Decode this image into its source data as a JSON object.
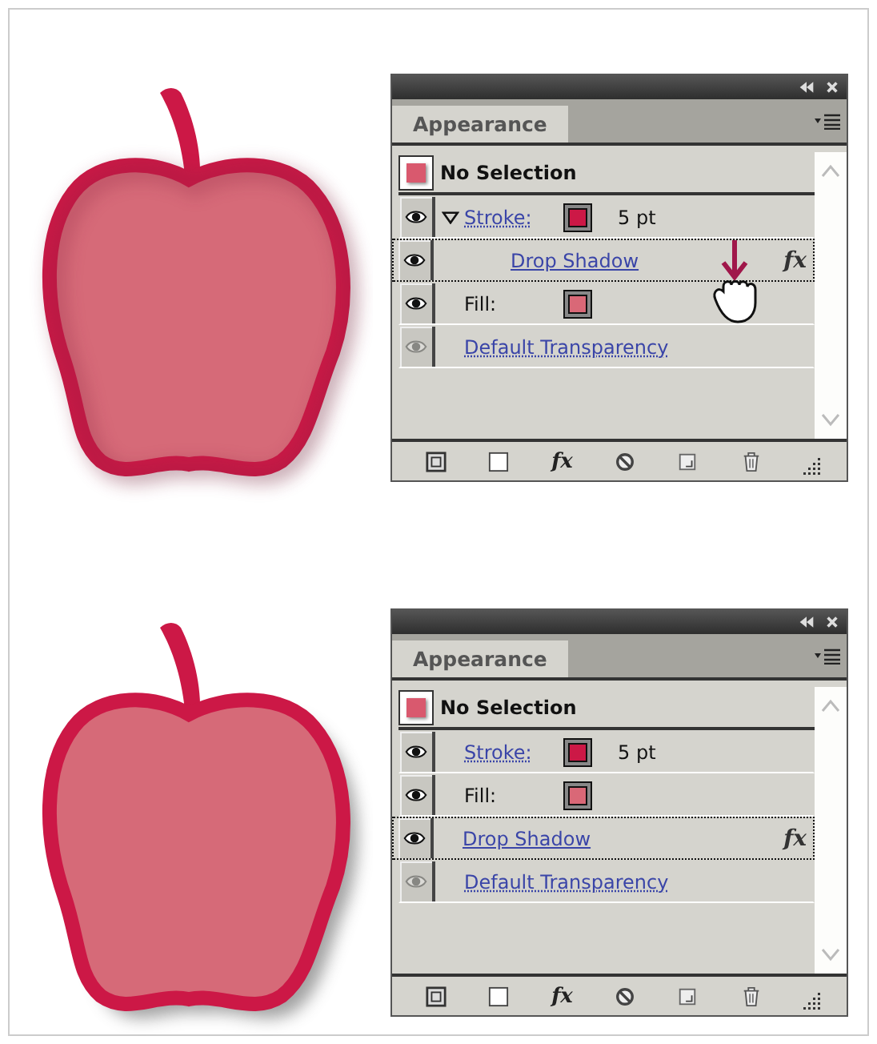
{
  "figures": [
    {
      "apple": {
        "shadow_inside": true
      },
      "cursor": true,
      "panel": {
        "tab": "Appearance",
        "header": {
          "label": "No Selection",
          "color": "#d9596e"
        },
        "rows": [
          {
            "kind": "stroke",
            "label": "Stroke:",
            "color": "#cc1846",
            "value": "5 pt",
            "visible": true,
            "selected": false,
            "expanded": true,
            "children": [
              {
                "kind": "effect",
                "label": "Drop Shadow",
                "fx": "fx",
                "visible": true,
                "selected": true
              }
            ]
          },
          {
            "kind": "fill",
            "label": "Fill:",
            "color": "#d96877",
            "visible": true,
            "selected": false
          },
          {
            "kind": "transparency",
            "label": "Default Transparency",
            "visible": false,
            "selected": false
          }
        ],
        "footer_fx": "fx"
      }
    },
    {
      "apple": {
        "shadow_inside": false
      },
      "cursor": false,
      "panel": {
        "tab": "Appearance",
        "header": {
          "label": "No Selection",
          "color": "#d9596e"
        },
        "rows": [
          {
            "kind": "stroke",
            "label": "Stroke:",
            "color": "#cc1846",
            "value": "5 pt",
            "visible": true,
            "selected": false
          },
          {
            "kind": "fill",
            "label": "Fill:",
            "color": "#d96877",
            "visible": true,
            "selected": false
          },
          {
            "kind": "effect",
            "label": "Drop Shadow",
            "fx": "fx",
            "visible": true,
            "selected": true
          },
          {
            "kind": "transparency",
            "label": "Default Transparency",
            "visible": false,
            "selected": false
          }
        ],
        "footer_fx": "fx"
      }
    }
  ]
}
